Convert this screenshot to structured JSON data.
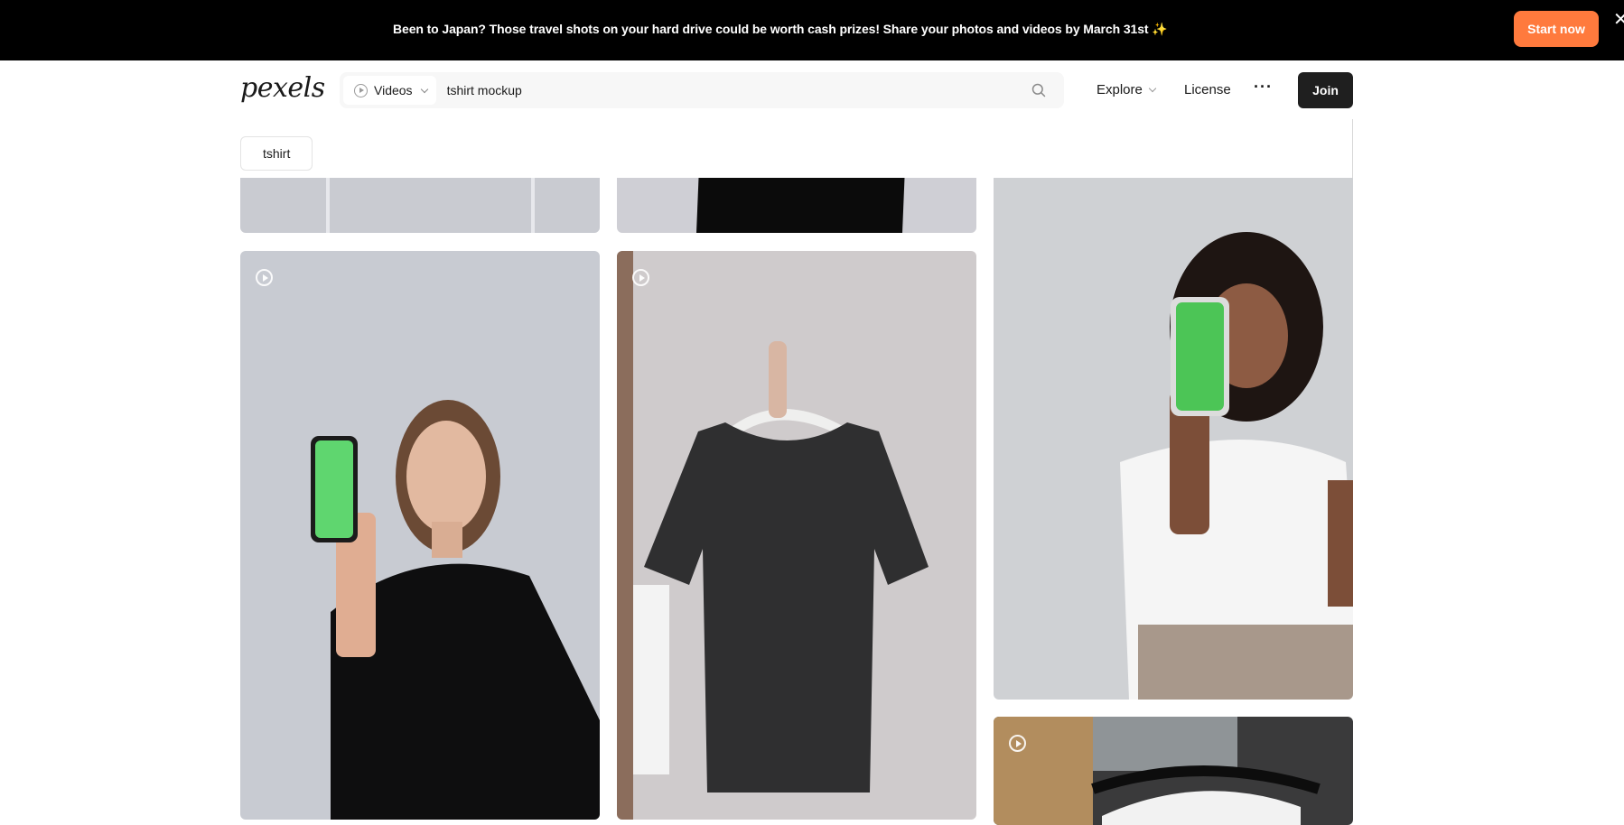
{
  "banner": {
    "message": "Been to Japan? Those travel shots on your hard drive could be worth cash prizes! Share your photos and videos by March 31st ✨",
    "cta_label": "Start now",
    "close_glyph": "✕"
  },
  "header": {
    "logo_text": "pexels",
    "search": {
      "type_label": "Videos",
      "query": "tshirt mockup"
    },
    "nav": {
      "explore_label": "Explore",
      "license_label": "License",
      "more_label": "···",
      "join_label": "Join"
    }
  },
  "suggestions": [
    "tshirt"
  ],
  "icons": {
    "search": "search-icon",
    "video": "play-circle-icon",
    "close": "close-icon",
    "chevron": "chevron-down-icon",
    "more": "ellipsis-icon"
  },
  "colors": {
    "banner_bg": "#000000",
    "cta": "#ff7a3d",
    "join_bg": "#1f1f1f",
    "search_bg": "#f7f7f7"
  },
  "results": [
    {
      "kind": "video",
      "subject": "woman holding green-screen phone in black t-shirt"
    },
    {
      "kind": "video",
      "subject": "black t-shirt on hanger"
    },
    {
      "kind": "video",
      "subject": "woman holding green-screen phone in white t-shirt"
    },
    {
      "kind": "video",
      "subject": "folded clothes"
    }
  ]
}
